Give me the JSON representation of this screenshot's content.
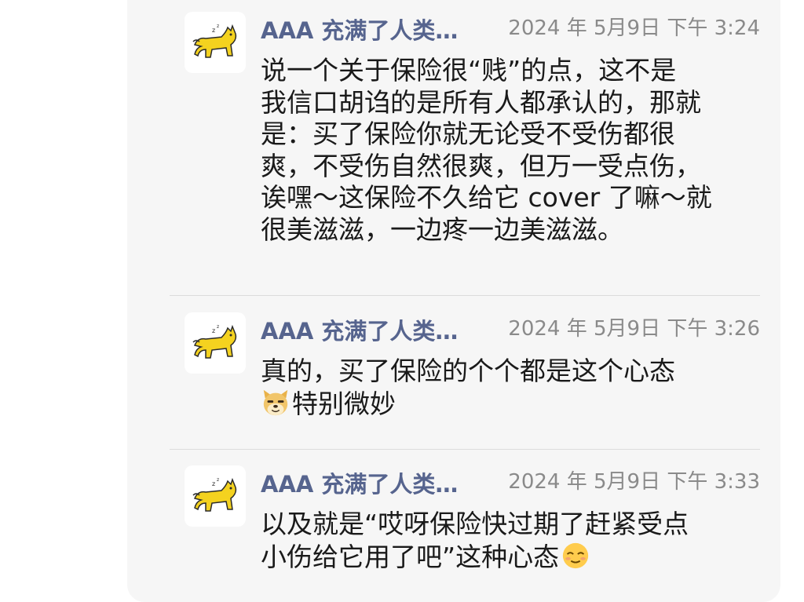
{
  "comments": [
    {
      "author": "AAA 充满了人类…",
      "time": "2024 年 5月9日 下午 3:24",
      "lines": [
        "说一个关于保险很“贱”的点，这不是",
        "我信口胡诌的是所有人都承认的，那就",
        "是：买了保险你就无论受不受伤都很",
        "爽，不受伤自然很爽，但万一受点伤，",
        "诶嘿～这保险不久给它 cover 了嘛～就",
        "很美滋滋，一边疼一边美滋滋。"
      ]
    },
    {
      "author": "AAA 充满了人类…",
      "time": "2024 年 5月9日 下午 3:26",
      "lines": [
        "真的，买了保险的个个都是这个心态",
        "特别微妙"
      ],
      "emoji_icon": "doge-emoji-icon"
    },
    {
      "author": "AAA 充满了人类…",
      "time": "2024 年 5月9日 下午 3:33",
      "lines": [
        "以及就是“哎呀保险快过期了赶紧受点",
        "小伤给它用了吧”这种心态"
      ],
      "emoji_icon": "relieved-face-emoji-icon"
    }
  ],
  "colors": {
    "author": "#56648e",
    "time": "#8a8a8a",
    "text": "#1a1a1a",
    "panel": "#f6f6f6",
    "avatar_cat": "#f4d21f"
  },
  "avatar_icon": "yellow-cat-icon"
}
